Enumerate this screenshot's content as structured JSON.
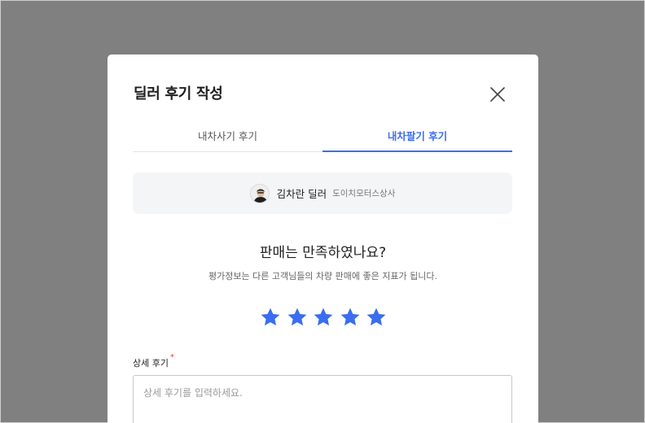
{
  "modal": {
    "title": "딜러 후기 작성",
    "close_icon": "close-icon"
  },
  "tabs": [
    {
      "label": "내차사기 후기",
      "active": false
    },
    {
      "label": "내차팔기 후기",
      "active": true
    }
  ],
  "dealer": {
    "avatar_icon": "dealer-avatar",
    "name": "김차란 딜러",
    "company": "도이치모터스상사"
  },
  "rating": {
    "question": "판매는 만족하였나요?",
    "subtitle": "평가정보는 다른 고객님들의 차량 판매에 좋은 지표가 됩니다.",
    "stars": 5,
    "max_stars": 5,
    "star_color": "#3a6df0"
  },
  "review": {
    "label": "상세 후기",
    "required_mark": "*",
    "placeholder": "상세 후기를 입력하세요.",
    "value": ""
  },
  "colors": {
    "accent": "#3a6df0",
    "backdrop": "#808080",
    "required": "#e8412c"
  }
}
